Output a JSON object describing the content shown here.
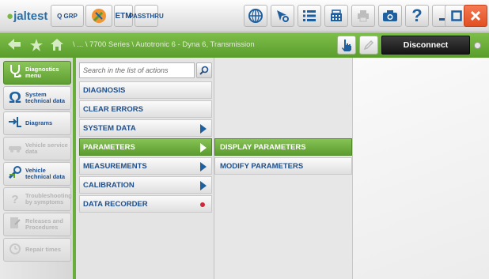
{
  "colors": {
    "brand_blue": "#1e5fa0",
    "nav_green": "#6aae3a",
    "active_green": "#5c9c30",
    "close_orange": "#e14f22",
    "recorder_red": "#d1273a"
  },
  "toolbar": {
    "logo_dot": "●",
    "logo_text": "jaltest",
    "grp_label": "Q GRP",
    "tool_icon": "wrench-icon",
    "etm_label": "ETM",
    "pass_line1": "PASS",
    "pass_line2": "THRU",
    "icons": [
      "globe-icon",
      "settings-icon",
      "list-icon",
      "calculator-icon",
      "print-icon",
      "camera-icon"
    ],
    "help_label": "?",
    "minimize_icon": "minimize-icon",
    "maximize_icon": "maximize-icon",
    "close_icon": "close-icon"
  },
  "nav": {
    "breadcrumb": "\\ ... \\ 7700 Series \\ Autotronic 6 - Dyna 6, Transmission",
    "disconnect_label": "Disconnect"
  },
  "sidebar": {
    "items": [
      {
        "label": "Diagnostics menu",
        "icon": "stethoscope-icon",
        "state": "active"
      },
      {
        "label": "System technical data",
        "icon": "omega-icon",
        "state": "normal"
      },
      {
        "label": "Diagrams",
        "icon": "diagram-icon",
        "state": "normal"
      },
      {
        "label": "Vehicle service data",
        "icon": "vehicle-service-icon",
        "state": "disabled"
      },
      {
        "label": "Vehicle technical data",
        "icon": "wrench-icon",
        "state": "normal"
      },
      {
        "label": "Troubleshooting by symptoms",
        "icon": "troubleshooting-icon",
        "state": "disabled"
      },
      {
        "label": "Releases and Procedures",
        "icon": "procedures-icon",
        "state": "disabled"
      },
      {
        "label": "Repair times",
        "icon": "repair-times-icon",
        "state": "disabled"
      }
    ]
  },
  "actions": {
    "search_placeholder": "Search in the list of actions",
    "items": [
      {
        "label": "DIAGNOSIS",
        "marker": "none"
      },
      {
        "label": "CLEAR ERRORS",
        "marker": "none"
      },
      {
        "label": "SYSTEM DATA",
        "marker": "arrow"
      },
      {
        "label": "PARAMETERS",
        "marker": "arrow",
        "active": true
      },
      {
        "label": "MEASUREMENTS",
        "marker": "arrow"
      },
      {
        "label": "CALIBRATION",
        "marker": "arrow"
      },
      {
        "label": "DATA RECORDER",
        "marker": "dot"
      }
    ]
  },
  "submenu": {
    "items": [
      {
        "label": "DISPLAY PARAMETERS",
        "active": true
      },
      {
        "label": "MODIFY PARAMETERS",
        "active": false
      }
    ]
  }
}
